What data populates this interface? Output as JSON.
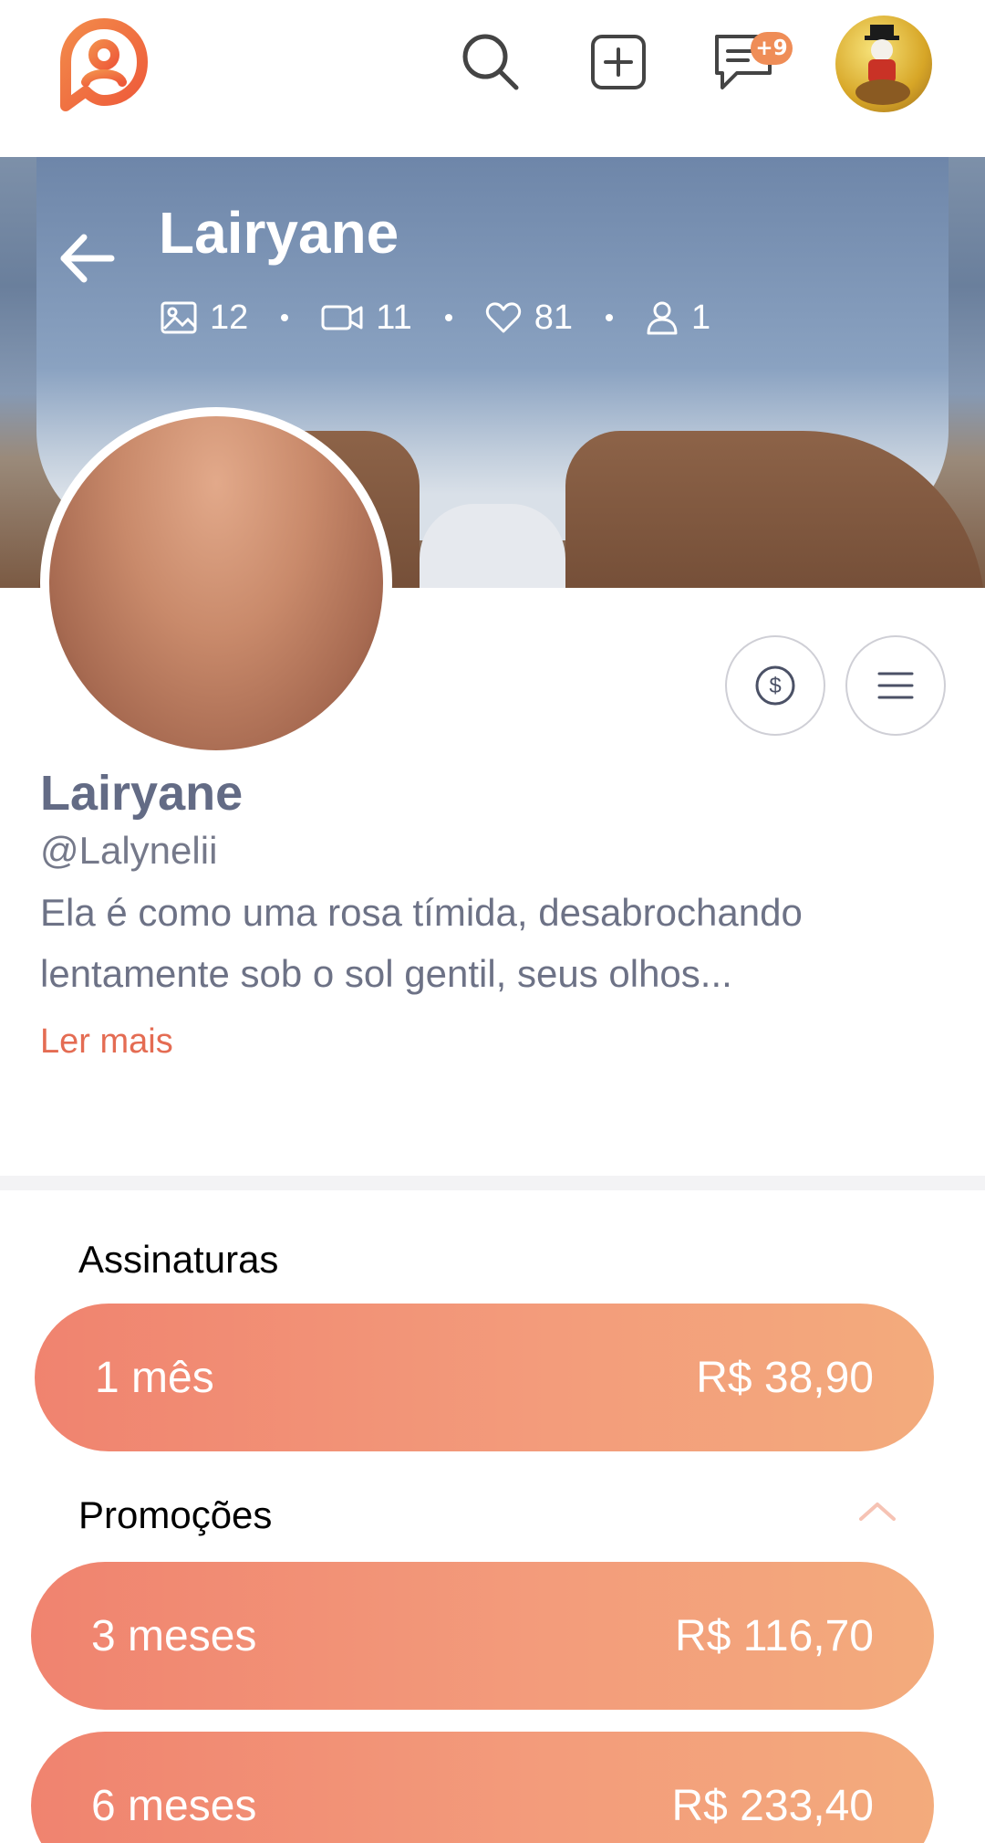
{
  "topbar": {
    "logo_icon": "brand-logo-icon",
    "search_icon": "search-icon",
    "create_icon": "plus-square-icon",
    "messages_icon": "chat-icon",
    "messages_badge": "+9",
    "avatar_icon": "user-avatar"
  },
  "cover": {
    "back_icon": "arrow-left-icon",
    "title": "Lairyane",
    "stats": {
      "photos": "12",
      "videos": "11",
      "likes": "81",
      "subscribers": "1"
    }
  },
  "profile": {
    "name": "Lairyane",
    "handle": "@Lalynelii",
    "bio_line1": "Ela é como uma rosa tímida, desabrochando",
    "bio_line2": "lentamente sob o sol gentil, seus olhos...",
    "read_more": "Ler mais",
    "tip_icon": "dollar-circle-icon",
    "menu_icon": "menu-icon"
  },
  "subscriptions": {
    "title": "Assinaturas",
    "plans": [
      {
        "label": "1 mês",
        "price": "R$ 38,90"
      }
    ]
  },
  "promotions": {
    "title": "Promoções",
    "toggle_icon": "chevron-up-icon",
    "plans": [
      {
        "label": "3 meses",
        "price": "R$ 116,70"
      },
      {
        "label": "6 meses",
        "price": "R$ 233,40"
      }
    ]
  },
  "colors": {
    "accent": "#e46c53",
    "plan_gradient_start": "#f0836f",
    "plan_gradient_end": "#f3ab7c",
    "badge": "#ef8d57",
    "name_text": "#636b85"
  }
}
